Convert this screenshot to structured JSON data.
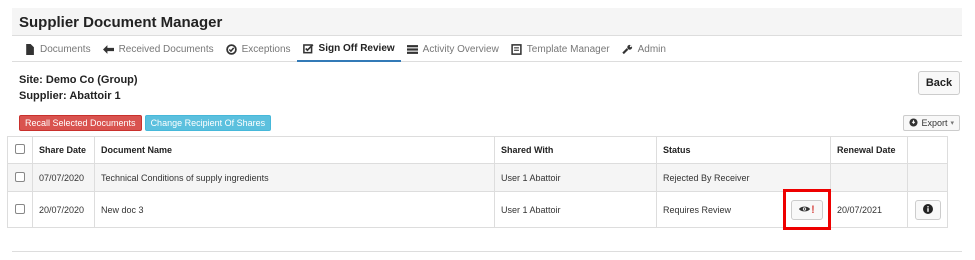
{
  "app": {
    "title": "Supplier Document Manager"
  },
  "tabs": [
    {
      "label": "Documents",
      "icon": "file-icon",
      "active": false
    },
    {
      "label": "Received Documents",
      "icon": "arrow-left-icon",
      "active": false
    },
    {
      "label": "Exceptions",
      "icon": "check-circle-icon",
      "active": false
    },
    {
      "label": "Sign Off Review",
      "icon": "checkbox-edit-icon",
      "active": true
    },
    {
      "label": "Activity Overview",
      "icon": "list-icon",
      "active": false
    },
    {
      "label": "Template Manager",
      "icon": "template-icon",
      "active": false
    },
    {
      "label": "Admin",
      "icon": "wrench-icon",
      "active": false
    }
  ],
  "info": {
    "site": "Site: Demo Co (Group)",
    "supplier": "Supplier: Abattoir 1"
  },
  "buttons": {
    "back": "Back",
    "recall": "Recall Selected Documents",
    "change_recipient": "Change Recipient Of Shares",
    "export": "Export"
  },
  "table": {
    "headers": {
      "share_date": "Share Date",
      "document_name": "Document Name",
      "shared_with": "Shared With",
      "status": "Status",
      "renewal_date": "Renewal Date"
    },
    "rows": [
      {
        "share_date": "07/07/2020",
        "document_name": "Technical Conditions of supply ingredients",
        "shared_with": "User 1 Abattoir",
        "status": "Rejected By Receiver",
        "renewal_date": ""
      },
      {
        "share_date": "20/07/2020",
        "document_name": "New doc 3",
        "shared_with": "User 1 Abattoir",
        "status": "Requires Review",
        "renewal_date": "20/07/2021"
      }
    ]
  },
  "colors": {
    "danger": "#d9534f",
    "info": "#5bc0de",
    "highlight": "#ee0000",
    "active_tab": "#337ab7"
  }
}
